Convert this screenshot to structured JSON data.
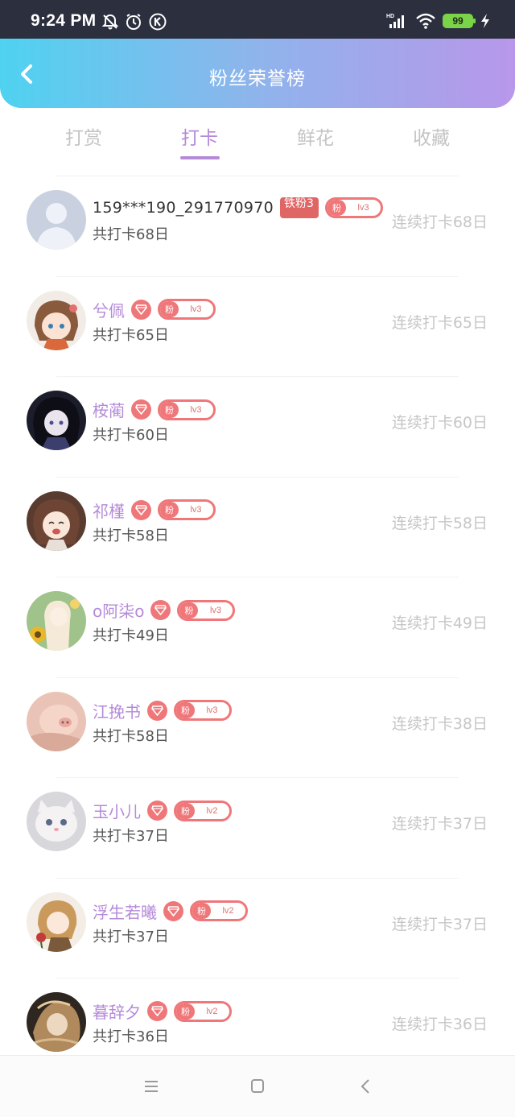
{
  "status_bar": {
    "time": "9:24 PM",
    "battery": "99",
    "icons": [
      "mute-icon",
      "alarm-icon",
      "k-icon",
      "signal-icon",
      "wifi-icon",
      "battery-icon",
      "charging-icon"
    ]
  },
  "header": {
    "title": "粉丝荣誉榜",
    "back_icon": "chevron-left-icon"
  },
  "tabs": [
    {
      "label": "打赏",
      "active": false
    },
    {
      "label": "打卡",
      "active": true
    },
    {
      "label": "鲜花",
      "active": false
    },
    {
      "label": "收藏",
      "active": false
    }
  ],
  "colors": {
    "accent": "#b58ad9",
    "badge": "#ef7779",
    "header_gradient": [
      "#4fd2f0",
      "#b897ea"
    ]
  },
  "fans": [
    {
      "name": "159***190_291770970",
      "total": "共打卡68日",
      "streak": "连续打卡68日",
      "iron_badge": "铁粉3",
      "heart": false,
      "fan_tag": "粉",
      "level": "lv3"
    },
    {
      "name": "兮佩",
      "total": "共打卡65日",
      "streak": "连续打卡65日",
      "heart": true,
      "fan_tag": "粉",
      "level": "lv3"
    },
    {
      "name": "桉蔺",
      "total": "共打卡60日",
      "streak": "连续打卡60日",
      "heart": true,
      "fan_tag": "粉",
      "level": "lv3"
    },
    {
      "name": "祁槿",
      "total": "共打卡58日",
      "streak": "连续打卡58日",
      "heart": true,
      "fan_tag": "粉",
      "level": "lv3"
    },
    {
      "name": "o阿柒o",
      "total": "共打卡49日",
      "streak": "连续打卡49日",
      "heart": true,
      "fan_tag": "粉",
      "level": "lv3"
    },
    {
      "name": "江挽书",
      "total": "共打卡58日",
      "streak": "连续打卡38日",
      "heart": true,
      "fan_tag": "粉",
      "level": "lv3"
    },
    {
      "name": "玉小儿",
      "total": "共打卡37日",
      "streak": "连续打卡37日",
      "heart": true,
      "fan_tag": "粉",
      "level": "lv2"
    },
    {
      "name": "浮生若曦",
      "total": "共打卡37日",
      "streak": "连续打卡37日",
      "heart": true,
      "fan_tag": "粉",
      "level": "lv2"
    },
    {
      "name": "暮辞夕",
      "total": "共打卡36日",
      "streak": "连续打卡36日",
      "heart": true,
      "fan_tag": "粉",
      "level": "lv2"
    }
  ],
  "nav": [
    "menu-icon",
    "home-square-icon",
    "back-triangle-icon"
  ]
}
